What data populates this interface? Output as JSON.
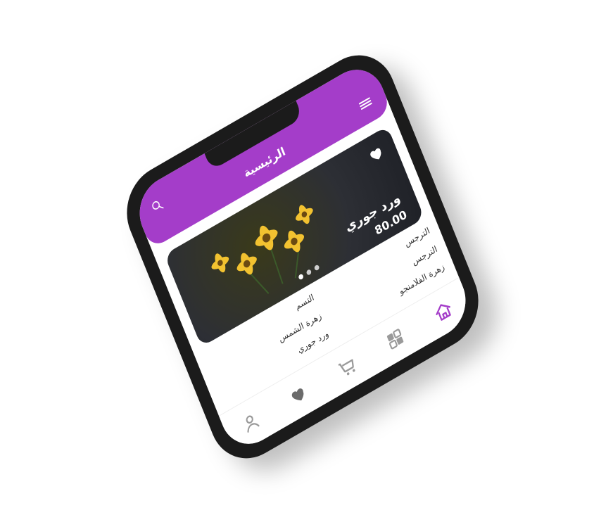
{
  "app": {
    "title": "الرئيسية"
  },
  "hero": {
    "title": "ورد جوري",
    "price": "80.00",
    "dots": {
      "count": 3,
      "active": 0
    }
  },
  "products": [
    {
      "name": "التسم"
    },
    {
      "name": "الترجس"
    },
    {
      "name": "زهرة الشمس"
    },
    {
      "name": "الترجس"
    },
    {
      "name": "ورد جوري"
    },
    {
      "name": "زهرة الفلامنجو"
    }
  ],
  "colors": {
    "accent": "#a43dc9",
    "accent_light": "#d08be8",
    "dark": "#1b1b1b"
  },
  "icons": {
    "search": "search-icon",
    "menu": "menu-icon",
    "favorite": "heart-icon",
    "home": "home-icon",
    "categories": "grid-icon",
    "cart": "cart-icon",
    "profile": "user-icon"
  }
}
